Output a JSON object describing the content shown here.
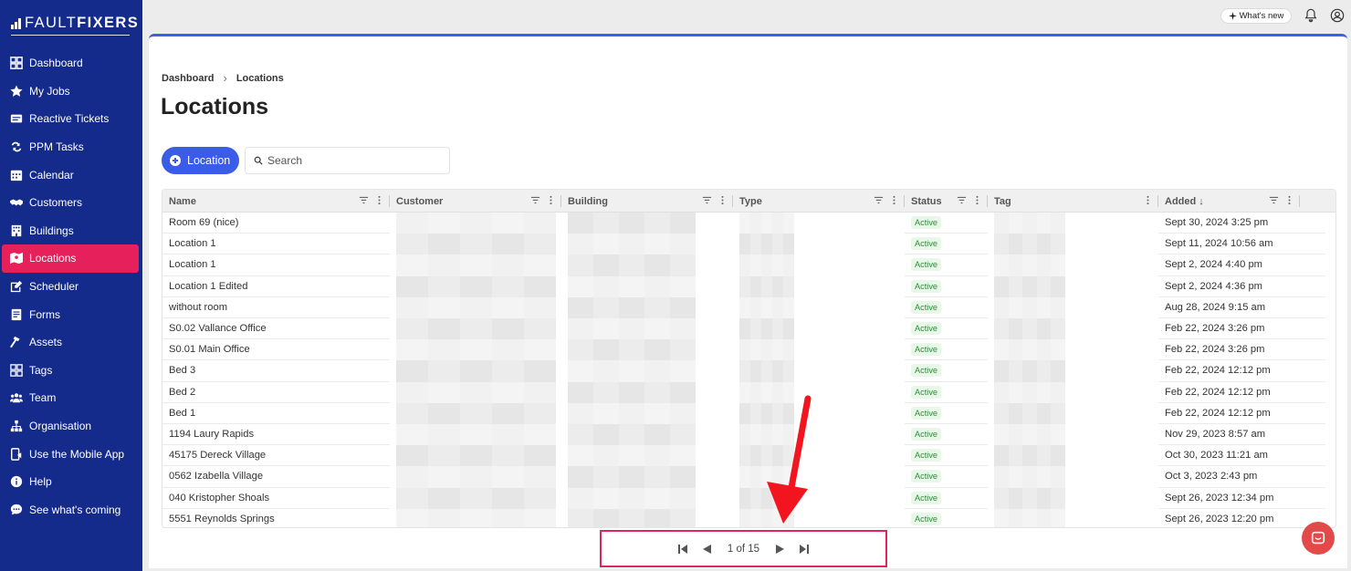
{
  "brand": {
    "name_light": "FAULT",
    "name_bold": "FIXERS"
  },
  "sidebar": {
    "items": [
      {
        "label": "Dashboard",
        "icon": "dashboard-icon"
      },
      {
        "label": "My Jobs",
        "icon": "star-icon"
      },
      {
        "label": "Reactive Tickets",
        "icon": "ticket-icon"
      },
      {
        "label": "PPM Tasks",
        "icon": "repeat-icon"
      },
      {
        "label": "Calendar",
        "icon": "calendar-icon"
      },
      {
        "label": "Customers",
        "icon": "handshake-icon"
      },
      {
        "label": "Buildings",
        "icon": "building-icon"
      },
      {
        "label": "Locations",
        "icon": "map-icon",
        "active": true
      },
      {
        "label": "Scheduler",
        "icon": "edit-icon"
      },
      {
        "label": "Forms",
        "icon": "form-icon"
      },
      {
        "label": "Assets",
        "icon": "hammer-icon"
      },
      {
        "label": "Tags",
        "icon": "grid-icon"
      },
      {
        "label": "Team",
        "icon": "team-icon"
      },
      {
        "label": "Organisation",
        "icon": "org-icon"
      },
      {
        "label": "Use the Mobile App",
        "icon": "mobile-icon"
      },
      {
        "label": "Help",
        "icon": "info-icon"
      },
      {
        "label": "See what's coming",
        "icon": "chat-icon"
      }
    ]
  },
  "topbar": {
    "whats_new": "What's new"
  },
  "breadcrumb": {
    "root": "Dashboard",
    "current": "Locations"
  },
  "page": {
    "title": "Locations"
  },
  "toolbar": {
    "add_label": "Location",
    "search_placeholder": "Search"
  },
  "table": {
    "columns": [
      "Name",
      "Customer",
      "Building",
      "Type",
      "Status",
      "Tag",
      "Added"
    ],
    "rows": [
      {
        "name": "Room 69 (nice)",
        "status": "Active",
        "added": "Sept 30, 2024 3:25 pm"
      },
      {
        "name": "Location 1",
        "status": "Active",
        "added": "Sept 11, 2024 10:56 am"
      },
      {
        "name": "Location 1",
        "status": "Active",
        "added": "Sept 2, 2024 4:40 pm"
      },
      {
        "name": "Location 1 Edited",
        "status": "Active",
        "added": "Sept 2, 2024 4:36 pm"
      },
      {
        "name": "without room",
        "status": "Active",
        "added": "Aug 28, 2024 9:15 am"
      },
      {
        "name": "S0.02 Vallance Office",
        "status": "Active",
        "added": "Feb 22, 2024 3:26 pm"
      },
      {
        "name": "S0.01 Main Office",
        "status": "Active",
        "added": "Feb 22, 2024 3:26 pm"
      },
      {
        "name": "Bed 3",
        "status": "Active",
        "added": "Feb 22, 2024 12:12 pm"
      },
      {
        "name": "Bed 2",
        "status": "Active",
        "added": "Feb 22, 2024 12:12 pm"
      },
      {
        "name": "Bed 1",
        "status": "Active",
        "added": "Feb 22, 2024 12:12 pm"
      },
      {
        "name": "1194 Laury Rapids",
        "status": "Active",
        "added": "Nov 29, 2023 8:57 am"
      },
      {
        "name": "45175 Dereck Village",
        "status": "Active",
        "added": "Oct 30, 2023 11:21 am"
      },
      {
        "name": "0562 Izabella Village",
        "status": "Active",
        "added": "Oct 3, 2023 2:43 pm"
      },
      {
        "name": "040 Kristopher Shoals",
        "status": "Active",
        "added": "Sept 26, 2023 12:34 pm"
      },
      {
        "name": "5551 Reynolds Springs",
        "status": "Active",
        "added": "Sept 26, 2023 12:20 pm"
      }
    ]
  },
  "pagination": {
    "text": "1 of 15"
  },
  "colors": {
    "sidebar": "#142b8c",
    "active": "#e5205a",
    "accent": "#3b5ce6",
    "highlight": "#e0245e"
  }
}
